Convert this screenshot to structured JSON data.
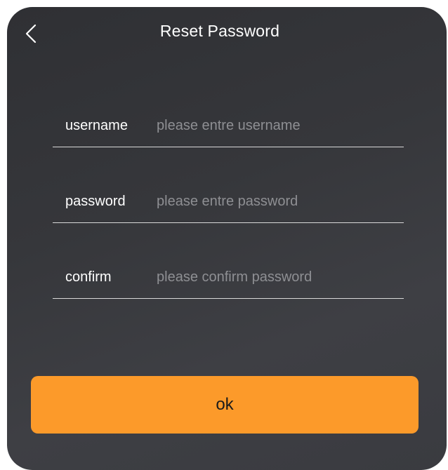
{
  "header": {
    "title": "Reset Password",
    "back_icon": "chevron-left-icon"
  },
  "form": {
    "fields": [
      {
        "label": "username",
        "placeholder": "please entre username",
        "value": ""
      },
      {
        "label": "password",
        "placeholder": "please entre password",
        "value": ""
      },
      {
        "label": "confirm",
        "placeholder": "please confirm password",
        "value": ""
      }
    ]
  },
  "actions": {
    "ok_label": "ok"
  },
  "colors": {
    "accent": "#fc9a2a",
    "panel_background": "#36373b",
    "text": "#ffffff",
    "placeholder": "#8e8f93",
    "divider": "#d9d9d9"
  }
}
